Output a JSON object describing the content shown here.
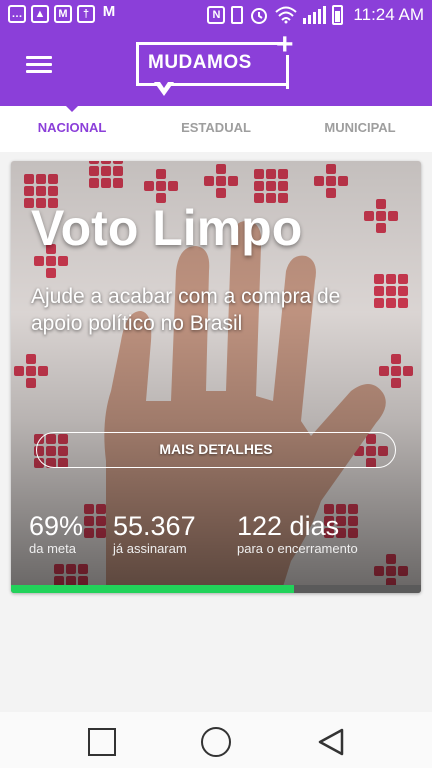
{
  "status_bar": {
    "time": "11:24 AM",
    "left_icons": [
      "chat-icon",
      "image-icon",
      "gmail-icon",
      "calendar-icon",
      "mail-icon"
    ],
    "right_icons": [
      "nfc-icon",
      "vibrate-icon",
      "alarm-icon",
      "wifi-icon",
      "signal-icon",
      "battery-icon"
    ]
  },
  "app_bar": {
    "logo_text": "MUDAMOS",
    "logo_plus": "+"
  },
  "tabs": [
    {
      "label": "NACIONAL",
      "active": true
    },
    {
      "label": "ESTADUAL",
      "active": false
    },
    {
      "label": "MUNICIPAL",
      "active": false
    }
  ],
  "card": {
    "title": "Voto Limpo",
    "subtitle": "Ajude a acabar com a compra de apoio político no Brasil",
    "button_label": "MAIS DETALHES",
    "stats": [
      {
        "value": "69%",
        "label": "da meta"
      },
      {
        "value": "55.367",
        "label": "já assinaram"
      },
      {
        "value": "122 dias",
        "label": "para o encerramento"
      }
    ],
    "progress_fraction": 0.69,
    "progress_color": "#22d25a"
  },
  "colors": {
    "brand": "#8b3fd9"
  }
}
